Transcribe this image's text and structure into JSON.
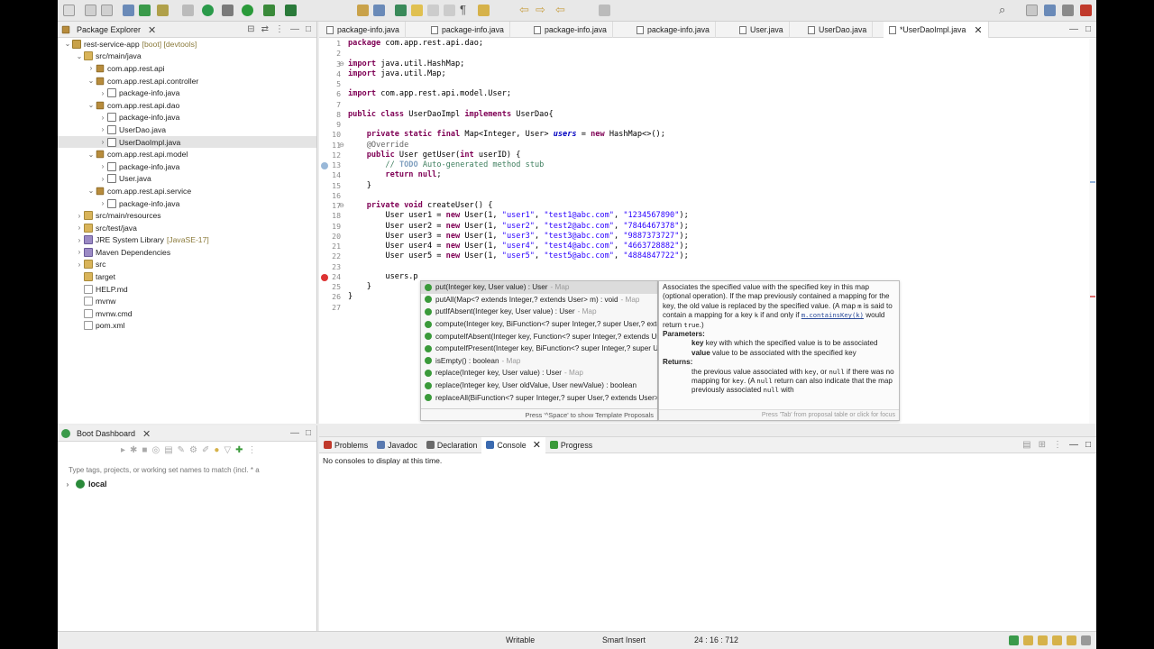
{
  "package_explorer": {
    "title": "Package Explorer",
    "tree": [
      {
        "label": "rest-service-app",
        "extra": "[boot] [devtools]",
        "indent": 0,
        "twisty": "v",
        "icon": "project-icon"
      },
      {
        "label": "src/main/java",
        "extra": "",
        "indent": 1,
        "twisty": "v",
        "icon": "source-folder-icon"
      },
      {
        "label": "com.app.rest.api",
        "extra": "",
        "indent": 2,
        "twisty": ">",
        "icon": "package-icon"
      },
      {
        "label": "com.app.rest.api.controller",
        "extra": "",
        "indent": 2,
        "twisty": "v",
        "icon": "package-icon"
      },
      {
        "label": "package-info.java",
        "extra": "",
        "indent": 3,
        "twisty": ">",
        "icon": "java-file-icon"
      },
      {
        "label": "com.app.rest.api.dao",
        "extra": "",
        "indent": 2,
        "twisty": "v",
        "icon": "package-icon"
      },
      {
        "label": "package-info.java",
        "extra": "",
        "indent": 3,
        "twisty": ">",
        "icon": "java-file-icon"
      },
      {
        "label": "UserDao.java",
        "extra": "",
        "indent": 3,
        "twisty": ">",
        "icon": "java-file-icon"
      },
      {
        "label": "UserDaoImpl.java",
        "extra": "",
        "indent": 3,
        "twisty": ">",
        "icon": "java-file-icon",
        "selected": true
      },
      {
        "label": "com.app.rest.api.model",
        "extra": "",
        "indent": 2,
        "twisty": "v",
        "icon": "package-icon"
      },
      {
        "label": "package-info.java",
        "extra": "",
        "indent": 3,
        "twisty": ">",
        "icon": "java-file-icon"
      },
      {
        "label": "User.java",
        "extra": "",
        "indent": 3,
        "twisty": ">",
        "icon": "java-file-icon"
      },
      {
        "label": "com.app.rest.api.service",
        "extra": "",
        "indent": 2,
        "twisty": "v",
        "icon": "package-icon"
      },
      {
        "label": "package-info.java",
        "extra": "",
        "indent": 3,
        "twisty": ">",
        "icon": "java-file-icon"
      },
      {
        "label": "src/main/resources",
        "extra": "",
        "indent": 1,
        "twisty": ">",
        "icon": "source-folder-icon"
      },
      {
        "label": "src/test/java",
        "extra": "",
        "indent": 1,
        "twisty": ">",
        "icon": "source-folder-icon"
      },
      {
        "label": "JRE System Library",
        "extra": "[JavaSE-17]",
        "indent": 1,
        "twisty": ">",
        "icon": "library-icon"
      },
      {
        "label": "Maven Dependencies",
        "extra": "",
        "indent": 1,
        "twisty": ">",
        "icon": "library-icon"
      },
      {
        "label": "src",
        "extra": "",
        "indent": 1,
        "twisty": ">",
        "icon": "folder-icon"
      },
      {
        "label": "target",
        "extra": "",
        "indent": 1,
        "twisty": "",
        "icon": "folder-icon"
      },
      {
        "label": "HELP.md",
        "extra": "",
        "indent": 1,
        "twisty": "",
        "icon": "file-icon"
      },
      {
        "label": "mvnw",
        "extra": "",
        "indent": 1,
        "twisty": "",
        "icon": "file-icon"
      },
      {
        "label": "mvnw.cmd",
        "extra": "",
        "indent": 1,
        "twisty": "",
        "icon": "file-icon"
      },
      {
        "label": "pom.xml",
        "extra": "",
        "indent": 1,
        "twisty": "",
        "icon": "file-icon"
      }
    ]
  },
  "editor": {
    "tabs": [
      {
        "label": "package-info.java",
        "active": false
      },
      {
        "label": "package-info.java",
        "active": false
      },
      {
        "label": "package-info.java",
        "active": false
      },
      {
        "label": "package-info.java",
        "active": false
      },
      {
        "label": "User.java",
        "active": false
      },
      {
        "label": "UserDao.java",
        "active": false
      },
      {
        "label": "*UserDaoImpl.java",
        "active": true
      }
    ],
    "lines": [
      {
        "n": "1",
        "html": "<span class='kw'>package</span> com.app.rest.api.dao;"
      },
      {
        "n": "2",
        "html": ""
      },
      {
        "n": "3",
        "html": "<span class='kw'>import</span> java.util.HashMap;"
      },
      {
        "n": "4",
        "html": "<span class='kw'>import</span> java.util.Map;"
      },
      {
        "n": "5",
        "html": ""
      },
      {
        "n": "6",
        "html": "<span class='kw'>import</span> com.app.rest.api.model.User;"
      },
      {
        "n": "7",
        "html": ""
      },
      {
        "n": "8",
        "html": "<span class='kw'>public</span> <span class='kw'>class</span> UserDaoImpl <span class='kw'>implements</span> UserDao{"
      },
      {
        "n": "9",
        "html": ""
      },
      {
        "n": "10",
        "html": "    <span class='kw'>private</span> <span class='kw'>static</span> <span class='kw'>final</span> Map&lt;Integer, User&gt; <span class='fld'>users</span> = <span class='kw'>new</span> HashMap&lt;&gt;();"
      },
      {
        "n": "11",
        "html": "    <span class='ann'>@Override</span>"
      },
      {
        "n": "12",
        "html": "    <span class='kw'>public</span> User getUser(<span class='kw'>int</span> userID) {"
      },
      {
        "n": "13",
        "html": "        <span class='cmt'>// <span class='todo'>TODO</span> Auto-generated method stub</span>"
      },
      {
        "n": "14",
        "html": "        <span class='kw'>return</span> <span class='kw'>null</span>;"
      },
      {
        "n": "15",
        "html": "    }"
      },
      {
        "n": "16",
        "html": ""
      },
      {
        "n": "17",
        "html": "    <span class='kw'>private</span> <span class='kw'>void</span> createUser() {"
      },
      {
        "n": "18",
        "html": "        User user1 = <span class='kw'>new</span> User(1, <span class='str'>\"user1\"</span>, <span class='str'>\"test1@abc.com\"</span>, <span class='str'>\"1234567890\"</span>);"
      },
      {
        "n": "19",
        "html": "        User user2 = <span class='kw'>new</span> User(1, <span class='str'>\"user2\"</span>, <span class='str'>\"test2@abc.com\"</span>, <span class='str'>\"7846467378\"</span>);"
      },
      {
        "n": "20",
        "html": "        User user3 = <span class='kw'>new</span> User(1, <span class='str'>\"user3\"</span>, <span class='str'>\"test3@abc.com\"</span>, <span class='str'>\"9887373727\"</span>);"
      },
      {
        "n": "21",
        "html": "        User user4 = <span class='kw'>new</span> User(1, <span class='str'>\"user4\"</span>, <span class='str'>\"test4@abc.com\"</span>, <span class='str'>\"4663728882\"</span>);"
      },
      {
        "n": "22",
        "html": "        User user5 = <span class='kw'>new</span> User(1, <span class='str'>\"user5\"</span>, <span class='str'>\"test5@abc.com\"</span>, <span class='str'>\"4884847722\"</span>);"
      },
      {
        "n": "23",
        "html": ""
      },
      {
        "n": "24",
        "html": "        users.p"
      },
      {
        "n": "25",
        "html": "    }"
      },
      {
        "n": "26",
        "html": "}"
      },
      {
        "n": "27",
        "html": ""
      }
    ]
  },
  "content_assist": {
    "items": [
      {
        "name": "put(Integer key, User value) : User",
        "src": "- Map",
        "bold": "p",
        "selected": true
      },
      {
        "name": "putAll(Map<? extends Integer,? extends User> m) : void",
        "src": "- Map",
        "bold": "p"
      },
      {
        "name": "putIfAbsent(Integer key, User value) : User",
        "src": "- Map",
        "bold": "p"
      },
      {
        "name": "compute(Integer key, BiFunction<? super Integer,? super User,? extends User> f) : User",
        "src": "",
        "bold": ""
      },
      {
        "name": "computeIfAbsent(Integer key, Function<? super Integer,? extends User> f) : User",
        "src": "",
        "bold": ""
      },
      {
        "name": "computeIfPresent(Integer key, BiFunction<? super Integer,? super User,? extends User> f)",
        "src": "",
        "bold": ""
      },
      {
        "name": "isEmpty() : boolean",
        "src": "- Map",
        "bold": ""
      },
      {
        "name": "replace(Integer key, User value) : User",
        "src": "- Map",
        "bold": ""
      },
      {
        "name": "replace(Integer key, User oldValue, User newValue) : boolean",
        "src": "",
        "bold": ""
      },
      {
        "name": "replaceAll(BiFunction<? super Integer,? super User,? extends User> f)",
        "src": "",
        "bold": ""
      }
    ],
    "footer": "Press '^Space' to show Template Proposals"
  },
  "javadoc": {
    "summary_html": "Associates the specified value with the specified key in this map (optional operation). If the map previously contained a mapping for the key, the old value is replaced by the specified value. (A map <code>m</code> is said to contain a mapping for a key <code>k</code> if and only if <span class='lnk'>m.containsKey(k)</span> would return <code>true</code>.)",
    "params_title": "Parameters:",
    "param_key_name": "key",
    "param_key_desc": "key with which the specified value is to be associated",
    "param_value_name": "value",
    "param_value_desc": "value to be associated with the specified key",
    "returns_title": "Returns:",
    "returns_html": "the previous value associated with <code>key</code>, or <code>null</code> if there was no mapping for <code>key</code>. (A <code>null</code> return can also indicate that the map previously associated <code>null</code> with",
    "footer": "Press 'Tab' from proposal table or click for focus"
  },
  "boot_dashboard": {
    "title": "Boot Dashboard",
    "filter_placeholder": "Type tags, projects, or working set names to match (incl. * a",
    "local_label": "local"
  },
  "console": {
    "tabs": [
      {
        "label": "Problems",
        "name": "tab-problems",
        "icon_color": "#c0392b"
      },
      {
        "label": "Javadoc",
        "name": "tab-javadoc",
        "icon_color": "#5a7ab0"
      },
      {
        "label": "Declaration",
        "name": "tab-declaration",
        "icon_color": "#6a6a6a"
      },
      {
        "label": "Console",
        "name": "tab-console",
        "icon_color": "#3a6ab0",
        "active": true
      },
      {
        "label": "Progress",
        "name": "tab-progress",
        "icon_color": "#3a9a3a"
      }
    ],
    "message": "No consoles to display at this time."
  },
  "status_bar": {
    "writable": "Writable",
    "insert_mode": "Smart Insert",
    "position": "24 : 16 : 712"
  }
}
